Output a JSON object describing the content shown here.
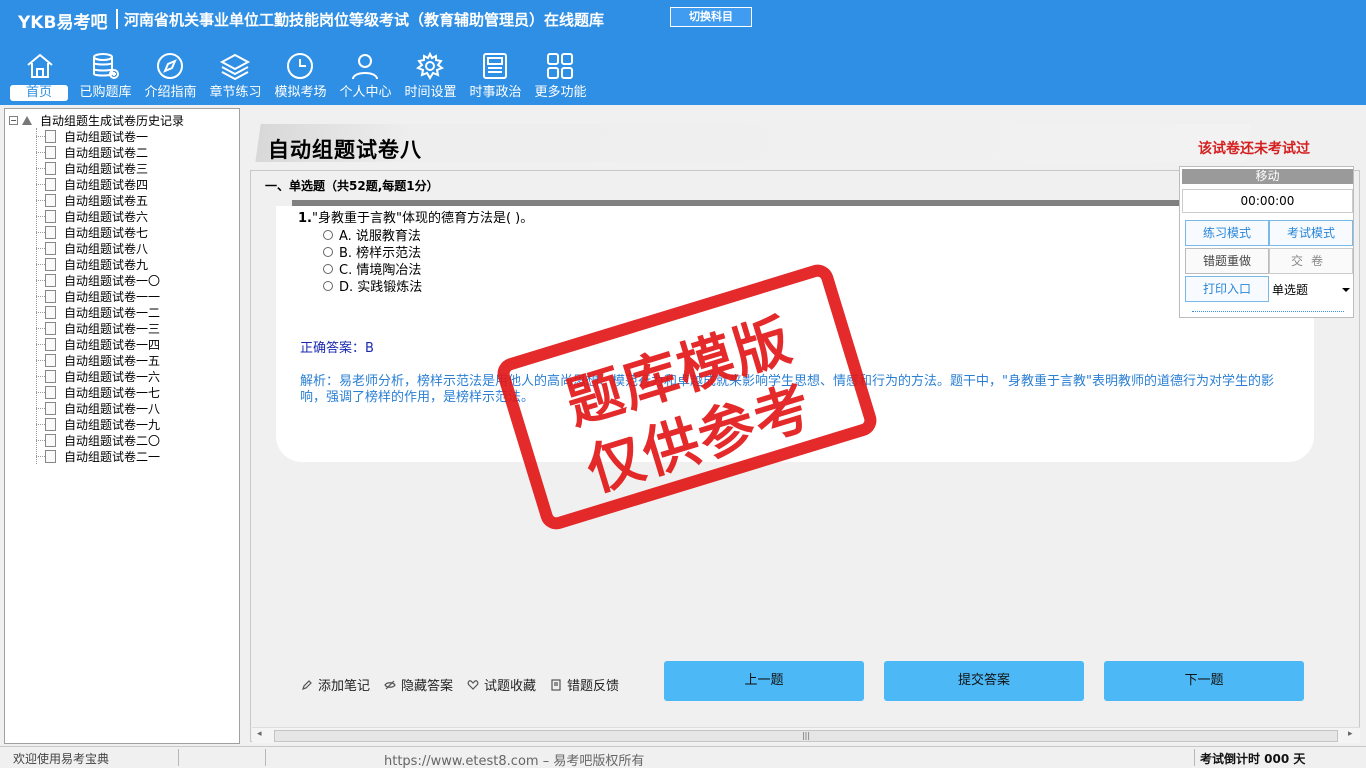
{
  "header": {
    "brand": "YKB易考吧",
    "title": "河南省机关事业单位工勤技能岗位等级考试（教育辅助管理员）在线题库",
    "switch_label": "切换科目"
  },
  "nav": [
    {
      "label": "首页",
      "icon": "home-icon"
    },
    {
      "label": "已购题库",
      "icon": "database-icon"
    },
    {
      "label": "介绍指南",
      "icon": "compass-icon"
    },
    {
      "label": "章节练习",
      "icon": "layers-icon"
    },
    {
      "label": "模拟考场",
      "icon": "clock-icon"
    },
    {
      "label": "个人中心",
      "icon": "user-icon"
    },
    {
      "label": "时间设置",
      "icon": "gear-icon"
    },
    {
      "label": "时事政治",
      "icon": "newspaper-icon"
    },
    {
      "label": "更多功能",
      "icon": "grid-icon"
    }
  ],
  "tree": {
    "root": "自动组题生成试卷历史记录",
    "items": [
      "自动组题试卷一",
      "自动组题试卷二",
      "自动组题试卷三",
      "自动组题试卷四",
      "自动组题试卷五",
      "自动组题试卷六",
      "自动组题试卷七",
      "自动组题试卷八",
      "自动组题试卷九",
      "自动组题试卷一〇",
      "自动组题试卷一一",
      "自动组题试卷一二",
      "自动组题试卷一三",
      "自动组题试卷一四",
      "自动组题试卷一五",
      "自动组题试卷一六",
      "自动组题试卷一七",
      "自动组题试卷一八",
      "自动组题试卷一九",
      "自动组题试卷二〇",
      "自动组题试卷二一"
    ]
  },
  "paper": {
    "title": "自动组题试卷八",
    "status": "该试卷还未考试过",
    "section": "一、单选题（共52题,每题1分）"
  },
  "question": {
    "number": "1.",
    "text": "\"身教重于言教\"体现的德育方法是( )。",
    "options": [
      "A. 说服教育法",
      "B. 榜样示范法",
      "C. 情境陶冶法",
      "D. 实践锻炼法"
    ],
    "answer": "正确答案：B",
    "analysis": "解析：易老师分析，榜样示范法是用他人的高尚思想、模范行为和卓越成就来影响学生思想、情感和行为的方法。题干中，\"身教重于言教\"表明教师的道德行为对学生的影响，强调了榜样的作用，是榜样示范法。"
  },
  "stamp": {
    "line1": "题库模版",
    "line2": "仅供参考"
  },
  "actions": {
    "note": "添加笔记",
    "hide": "隐藏答案",
    "fav": "试题收藏",
    "report": "错题反馈",
    "prev": "上一题",
    "submit": "提交答案",
    "next": "下一题"
  },
  "panel": {
    "move": "移动",
    "timer": "00:00:00",
    "practice": "练习模式",
    "exam": "考试模式",
    "redo": "错题重做",
    "hand_in": "交卷",
    "print": "打印入口",
    "type_select": "单选题"
  },
  "status": {
    "welcome": "欢迎使用易考宝典",
    "copyright": "https://www.etest8.com – 易考吧版权所有",
    "countdown": "考试倒计时 000 天"
  },
  "colors": {
    "header_bg": "#2f8fe4",
    "button_bg": "#4cb8f5",
    "stamp_red": "#e21818",
    "status_red": "#d42020"
  }
}
